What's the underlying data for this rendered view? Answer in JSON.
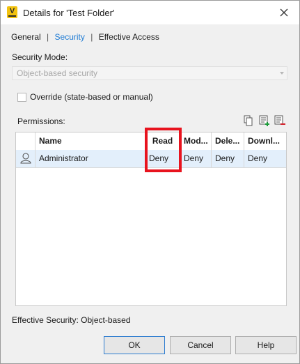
{
  "window": {
    "title": "Details for 'Test Folder'",
    "app_icon_letter": "V"
  },
  "tabs": [
    {
      "label": "General",
      "active": false
    },
    {
      "label": "Security",
      "active": true
    },
    {
      "label": "Effective Access",
      "active": false
    }
  ],
  "tab_separator": "|",
  "security_mode": {
    "label": "Security Mode:",
    "value": "Object-based security",
    "disabled": true
  },
  "override": {
    "label": "Override (state-based or manual)",
    "checked": false
  },
  "permissions": {
    "label": "Permissions:",
    "columns": [
      "Name",
      "Read",
      "Mod...",
      "Dele...",
      "Downl..."
    ],
    "rows": [
      {
        "icon": "user-icon",
        "name": "Administrator",
        "read": "Deny",
        "modify": "Deny",
        "delete": "Deny",
        "download": "Deny"
      }
    ],
    "highlighted_column": "Read",
    "highlight_color": "#e8131e",
    "selected_row_color": "#e3effb"
  },
  "effective_security": "Effective Security: Object-based",
  "buttons": {
    "ok": "OK",
    "cancel": "Cancel",
    "help": "Help"
  },
  "colors": {
    "accent": "#1e7bd4",
    "dialog_bg": "#f0f0f0",
    "icon_yellow": "#f2c20f"
  }
}
